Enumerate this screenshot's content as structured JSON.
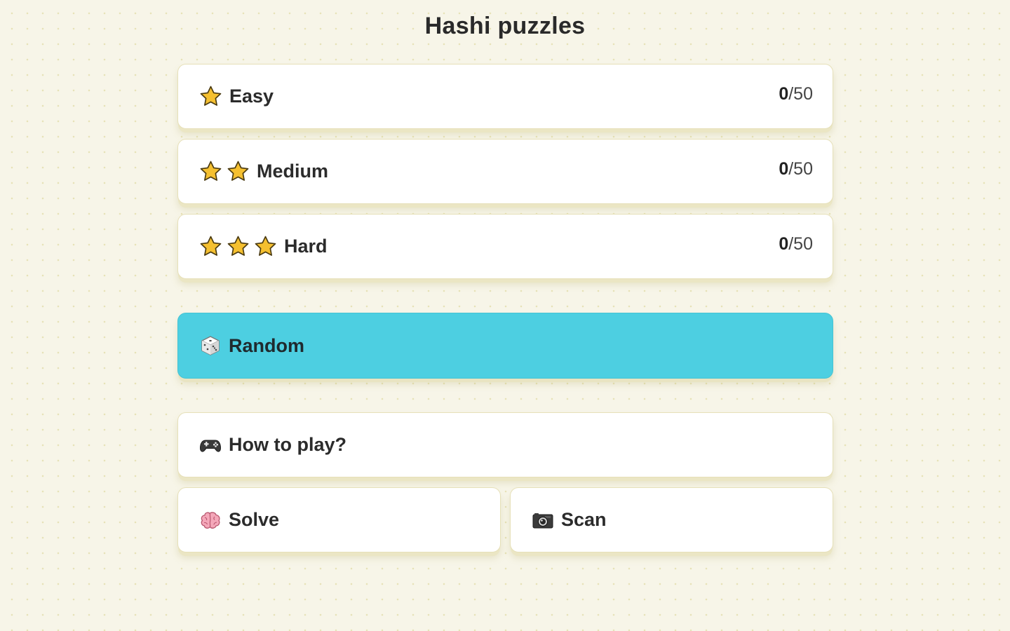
{
  "page": {
    "title": "Hashi puzzles"
  },
  "levels": [
    {
      "label": "Easy",
      "stars": 1,
      "solved": "0",
      "total": "/50"
    },
    {
      "label": "Medium",
      "stars": 2,
      "solved": "0",
      "total": "/50"
    },
    {
      "label": "Hard",
      "stars": 3,
      "solved": "0",
      "total": "/50"
    }
  ],
  "random": {
    "label": "Random",
    "icon": "dice-icon"
  },
  "how_to_play": {
    "label": "How to play?",
    "icon": "gamepad-icon"
  },
  "solve": {
    "label": "Solve",
    "icon": "brain-icon"
  },
  "scan": {
    "label": "Scan",
    "icon": "camera-icon"
  },
  "colors": {
    "background": "#f7f5e8",
    "card": "#ffffff",
    "accent": "#4dcfe1",
    "star": "#f5c030"
  }
}
